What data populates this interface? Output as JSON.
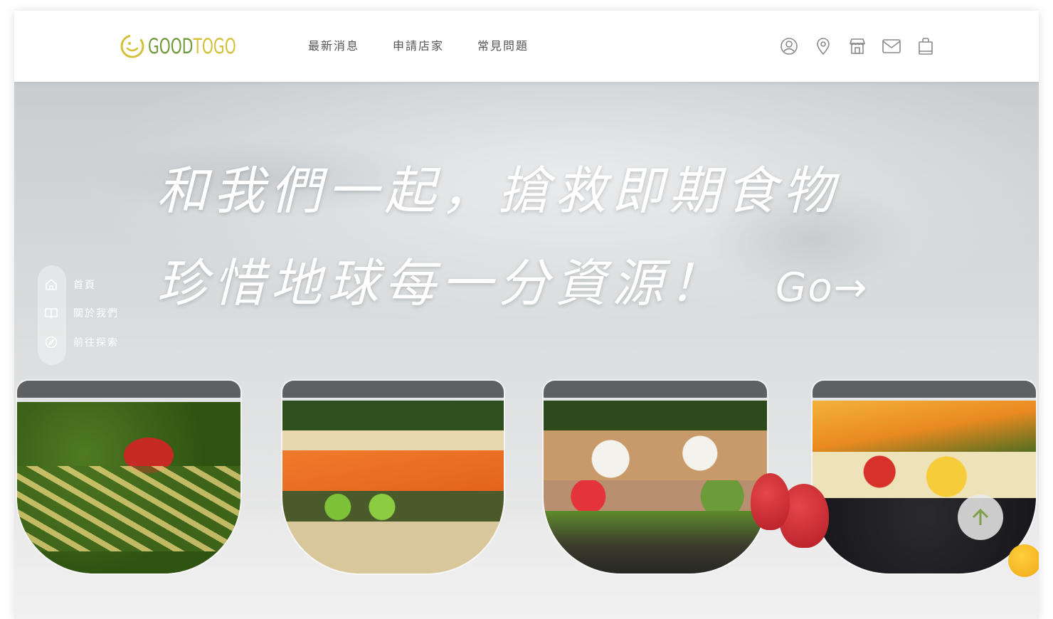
{
  "header": {
    "logo": {
      "part1": "GOOD",
      "part2": "TOGO",
      "color_primary": "#6f9a3b",
      "color_accent": "#d4c13a"
    },
    "nav": [
      {
        "label": "最新消息"
      },
      {
        "label": "申請店家"
      },
      {
        "label": "常見問題"
      }
    ],
    "icons": [
      "user-icon",
      "location-icon",
      "store-icon",
      "mail-icon",
      "shopping-bag-icon"
    ]
  },
  "hero": {
    "line1": "和我們一起，搶救即期食物",
    "line2": "珍惜地球每一分資源！",
    "cta": "Go→",
    "side_nav": [
      {
        "label": "首頁",
        "icon": "home-icon"
      },
      {
        "label": "關於我們",
        "icon": "book-icon"
      },
      {
        "label": "前往探索",
        "icon": "compass-icon"
      }
    ],
    "back_to_top_icon": "arrow-up-icon",
    "accent_color": "#7fa04a"
  }
}
